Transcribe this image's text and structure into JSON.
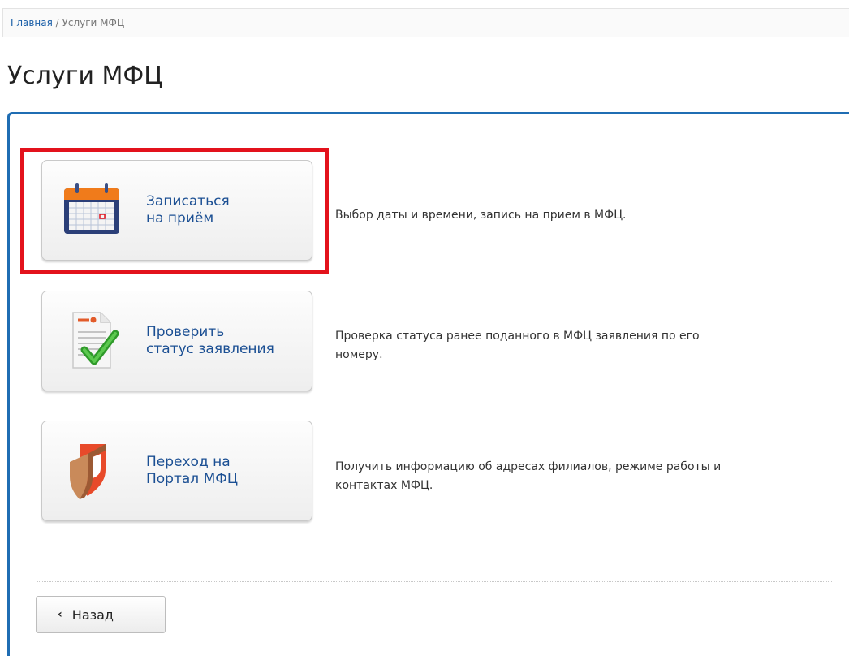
{
  "breadcrumb": {
    "home": "Главная",
    "separator": "/",
    "current": "Услуги МФЦ"
  },
  "page": {
    "title": "Услуги МФЦ"
  },
  "services": [
    {
      "label": "Записаться\nна приём",
      "description": "Выбор даты и времени, запись на прием в МФЦ.",
      "icon": "calendar-icon"
    },
    {
      "label": "Проверить\nстатус заявления",
      "description": "Проверка статуса ранее поданного в МФЦ заявления по его\nномеру.",
      "icon": "document-check-icon"
    },
    {
      "label": "Переход на\nПортал МФЦ",
      "description": "Получить информацию об адресах филиалов, режиме работы и\nконтактах МФЦ.",
      "icon": "mfc-logo-icon"
    }
  ],
  "back_button": {
    "label": "Назад",
    "chevron": "‹"
  },
  "colors": {
    "accent_blue": "#1f6db3",
    "link_blue": "#1b4f93",
    "highlight_red": "#e3121c"
  }
}
